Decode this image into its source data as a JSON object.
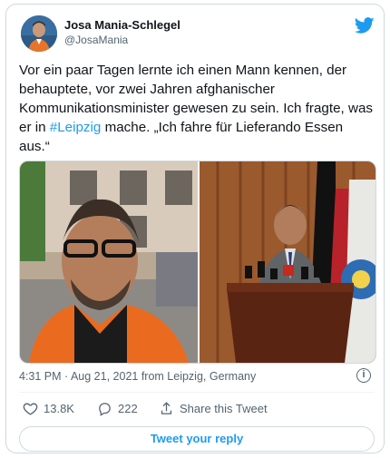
{
  "author": {
    "name": "Josa Mania-Schlegel",
    "handle": "@JosaMania"
  },
  "tweet": {
    "text_before": "Vor ein paar Tagen lernte ich einen Mann kennen, der behauptete, vor zwei Jahren afghanischer Kommunikationsminister gewesen zu sein. Ich fragte, was er in ",
    "hashtag": "#Leipzig",
    "text_after": " mache. „Ich fahre für Lieferando Essen aus.“",
    "timestamp": "4:31 PM · Aug 21, 2021 from Leipzig, Germany"
  },
  "media": {
    "left_icon": "selfie-photo",
    "right_icon": "press-conference-photo"
  },
  "actions": {
    "likes": "13.8K",
    "replies": "222",
    "share_label": "Share this Tweet",
    "info_glyph": "i"
  },
  "reply_button": "Tweet your reply",
  "colors": {
    "accent": "#1d9bf0",
    "text": "#0f1419",
    "muted": "#536471",
    "border": "#cfd9de"
  }
}
